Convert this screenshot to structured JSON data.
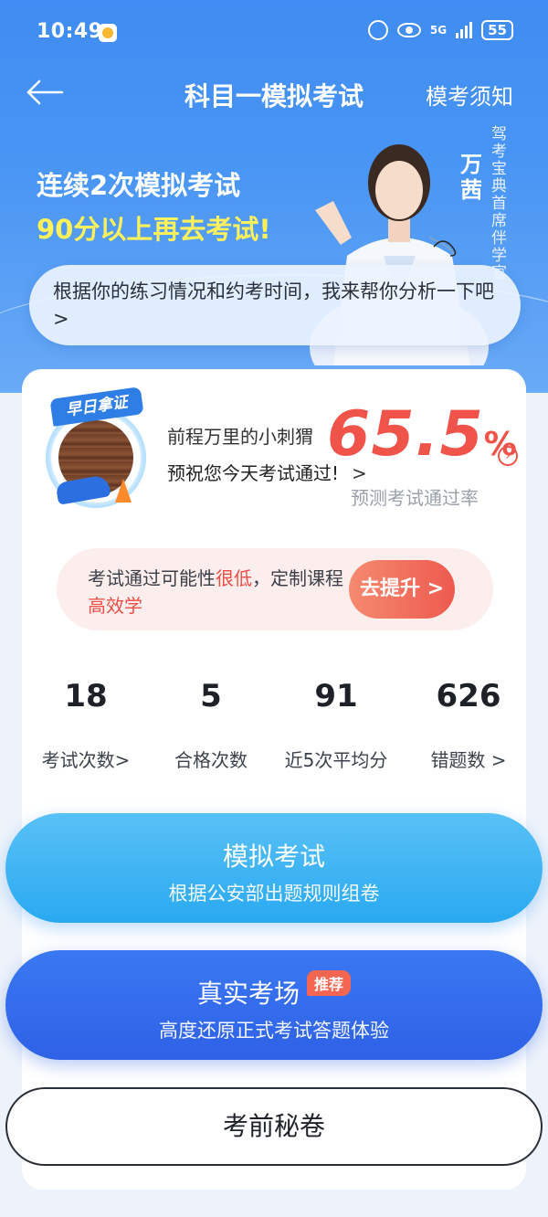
{
  "status_bar": {
    "time": "10:49",
    "network": "5G",
    "battery": "55"
  },
  "nav": {
    "title": "科目一模拟考试",
    "right_link": "模考须知"
  },
  "hero": {
    "slogan_line1": "连续2次模拟考试",
    "slogan_line2": "90分以上再去考试!",
    "person_name": "万茜",
    "person_role": "驾考宝典首席伴学官",
    "bubble_text": "根据你的练习情况和约考时间，我来帮你分析一下吧 >"
  },
  "profile": {
    "avatar_tag": "早日拿证",
    "user_name": "前程万里的小刺猬",
    "wish": "预祝您今天考试通过!",
    "wish_arrow": ">"
  },
  "pass_rate": {
    "value": "65.5",
    "unit": "%",
    "label": "预测考试通过率"
  },
  "improve": {
    "text_a": "考试通过可能性",
    "text_b": "很低",
    "text_c": "，定制课程",
    "text_d": "高效学",
    "button": "去提升 >"
  },
  "stats": [
    {
      "value": "18",
      "label": "考试次数>"
    },
    {
      "value": "5",
      "label": "合格次数"
    },
    {
      "value": "91",
      "label": "近5次平均分"
    },
    {
      "value": "626",
      "label": "错题数 >"
    }
  ],
  "buttons": {
    "sim_title": "模拟考试",
    "sim_sub": "根据公安部出题规则组卷",
    "real_title": "真实考场",
    "real_badge": "推荐",
    "real_sub": "高度还原正式考试答题体验",
    "secret": "考前秘卷"
  },
  "colors": {
    "accent_red": "#f05349",
    "primary_blue": "#3a78f2",
    "sky_blue": "#2aa9f1",
    "highlight_yellow": "#fff15c"
  }
}
